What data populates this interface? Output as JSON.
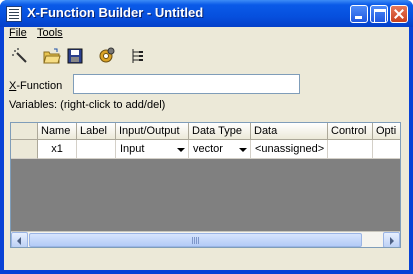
{
  "window": {
    "title": "X-Function Builder - Untitled"
  },
  "menu": {
    "file": "File",
    "tools": "Tools"
  },
  "toolbar": {
    "icons": [
      "wand-icon",
      "open-folder-icon",
      "save-icon",
      "gears-icon",
      "tree-view-icon"
    ]
  },
  "form": {
    "xfunction_label_first": "X",
    "xfunction_label_rest": "-Function",
    "xfunction_value": "",
    "variables_hint": "Variables: (right-click to add/del)"
  },
  "grid": {
    "columns": [
      "Name",
      "Label",
      "Input/Output",
      "Data Type",
      "Data",
      "Control",
      "Opti"
    ],
    "rows": [
      {
        "name": "x1",
        "label": "",
        "io": "Input",
        "data_type": "vector",
        "data": "<unassigned>",
        "control": "",
        "option": ""
      }
    ]
  },
  "colors": {
    "titlebar": "#0650de",
    "client": "#ece9d8",
    "grid_empty": "#808080"
  }
}
